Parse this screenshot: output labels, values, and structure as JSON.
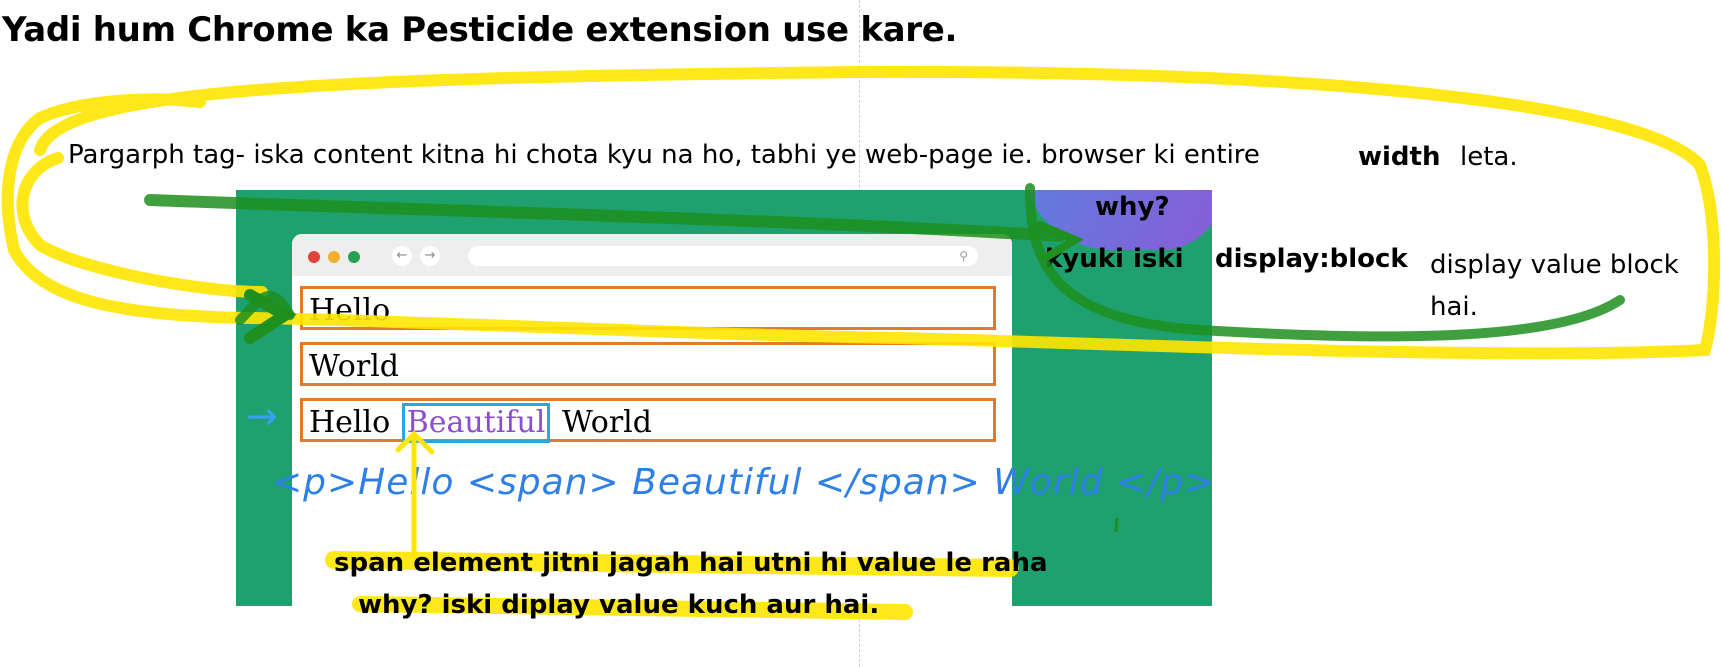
{
  "heading": "Yadi hum Chrome ka Pesticide extension use kare.",
  "paragraph": {
    "text": "Pargarph tag- iska content kitna hi chota kyu na ho, tabhi ye web-page ie. browser ki entire",
    "bold_word": "width",
    "ending": "leta."
  },
  "screenshot": {
    "boxes": [
      "Hello",
      "World"
    ],
    "mixed_line": {
      "before": "Hello",
      "span_word": "Beautiful",
      "after": "World"
    },
    "handwritten_code": "<p>Hello <span> Beautiful </span> World </p>"
  },
  "notes": {
    "why_top": "why?",
    "kyuki": "kyuki iski",
    "display_block": "display:block",
    "display_value": "display value block hai.",
    "span_note": "span element jitni jagah hai utni hi value le raha",
    "why_bottom": "why? iski diplay value kuch aur hai."
  },
  "colors": {
    "highlighter_yellow": "#ffe600",
    "pen_green": "#1f8f1f",
    "panel_green": "#1ea06f",
    "box_orange": "#e07a2c",
    "span_blue": "#29a8e0",
    "span_purple": "#8a4fd0"
  }
}
